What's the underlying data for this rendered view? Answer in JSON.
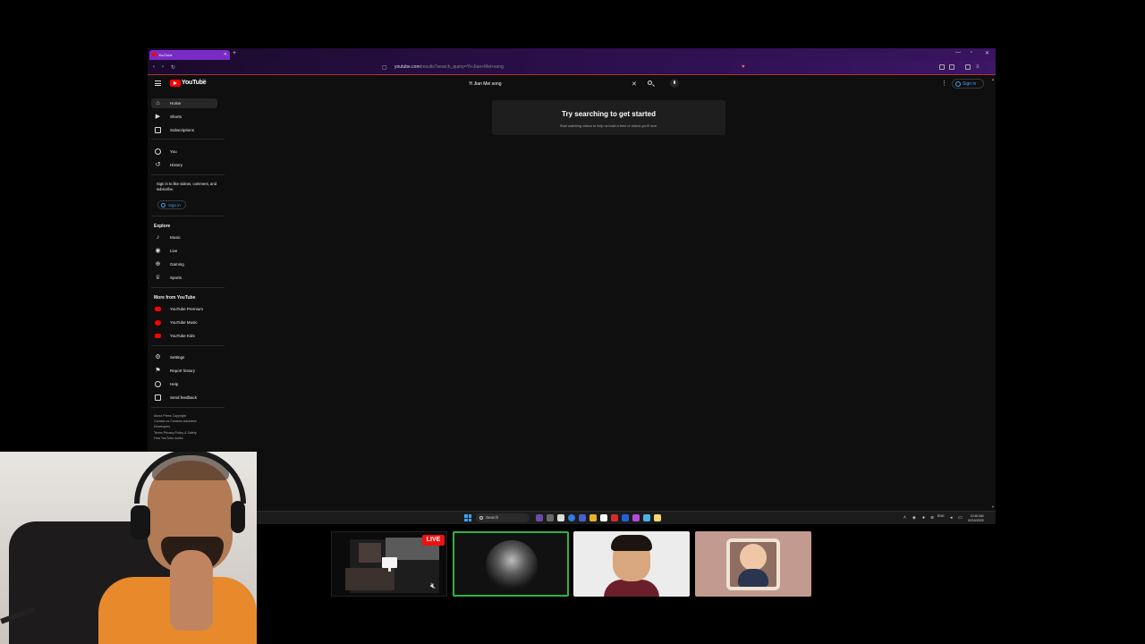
{
  "browser": {
    "tab_title": "YouTube",
    "url_host": "youtube.com",
    "url_rest": "/results?search_query=Yi+Jian+Mei+song"
  },
  "masthead": {
    "logo_text": "YouTube",
    "country_code": "CA",
    "search_value": "Yi Jian Mei song",
    "signin_label": "Sign in"
  },
  "sidebar": {
    "main_items": [
      {
        "label": "Home",
        "icon": "home-icon"
      },
      {
        "label": "Shorts",
        "icon": "shorts-icon"
      },
      {
        "label": "Subscriptions",
        "icon": "subscriptions-icon"
      }
    ],
    "you_items": [
      {
        "label": "You",
        "icon": "you-icon"
      },
      {
        "label": "History",
        "icon": "history-icon"
      }
    ],
    "signin_note": "Sign in to like videos, comment, and subscribe.",
    "signin_label": "Sign in",
    "explore_header": "Explore",
    "explore_items": [
      {
        "label": "Music",
        "icon": "music-icon"
      },
      {
        "label": "Live",
        "icon": "live-icon"
      },
      {
        "label": "Gaming",
        "icon": "gaming-icon"
      },
      {
        "label": "Sports",
        "icon": "sports-icon"
      }
    ],
    "more_header": "More from YouTube",
    "more_items": [
      {
        "label": "YouTube Premium",
        "icon": "youtube-premium-icon"
      },
      {
        "label": "YouTube Music",
        "icon": "youtube-music-icon"
      },
      {
        "label": "YouTube Kids",
        "icon": "youtube-kids-icon"
      }
    ],
    "settings_items": [
      {
        "label": "Settings",
        "icon": "gear-icon"
      },
      {
        "label": "Report history",
        "icon": "flag-icon"
      },
      {
        "label": "Help",
        "icon": "help-icon"
      },
      {
        "label": "Send feedback",
        "icon": "feedback-icon"
      }
    ],
    "footer_line1": "About  Press  Copyright",
    "footer_line2": "Contact us  Creators  Advertise",
    "footer_line3": "Developers",
    "footer_line4": "Terms  Privacy  Policy & Safety",
    "footer_line5": "How YouTube works"
  },
  "main": {
    "empty_title": "Try searching to get started",
    "empty_subtitle": "Start watching videos to help us build a feed of videos you'll love."
  },
  "taskbar": {
    "search_label": "Search",
    "tray_lang": "ENG",
    "time": "10:40 AM",
    "date": "02/15/2025"
  },
  "stream": {
    "live_label": "LIVE"
  },
  "colors": {
    "youtube_red": "#ff0000",
    "link_blue": "#3ea6ff",
    "active_border": "#2fb344",
    "live_red": "#ee1111"
  }
}
